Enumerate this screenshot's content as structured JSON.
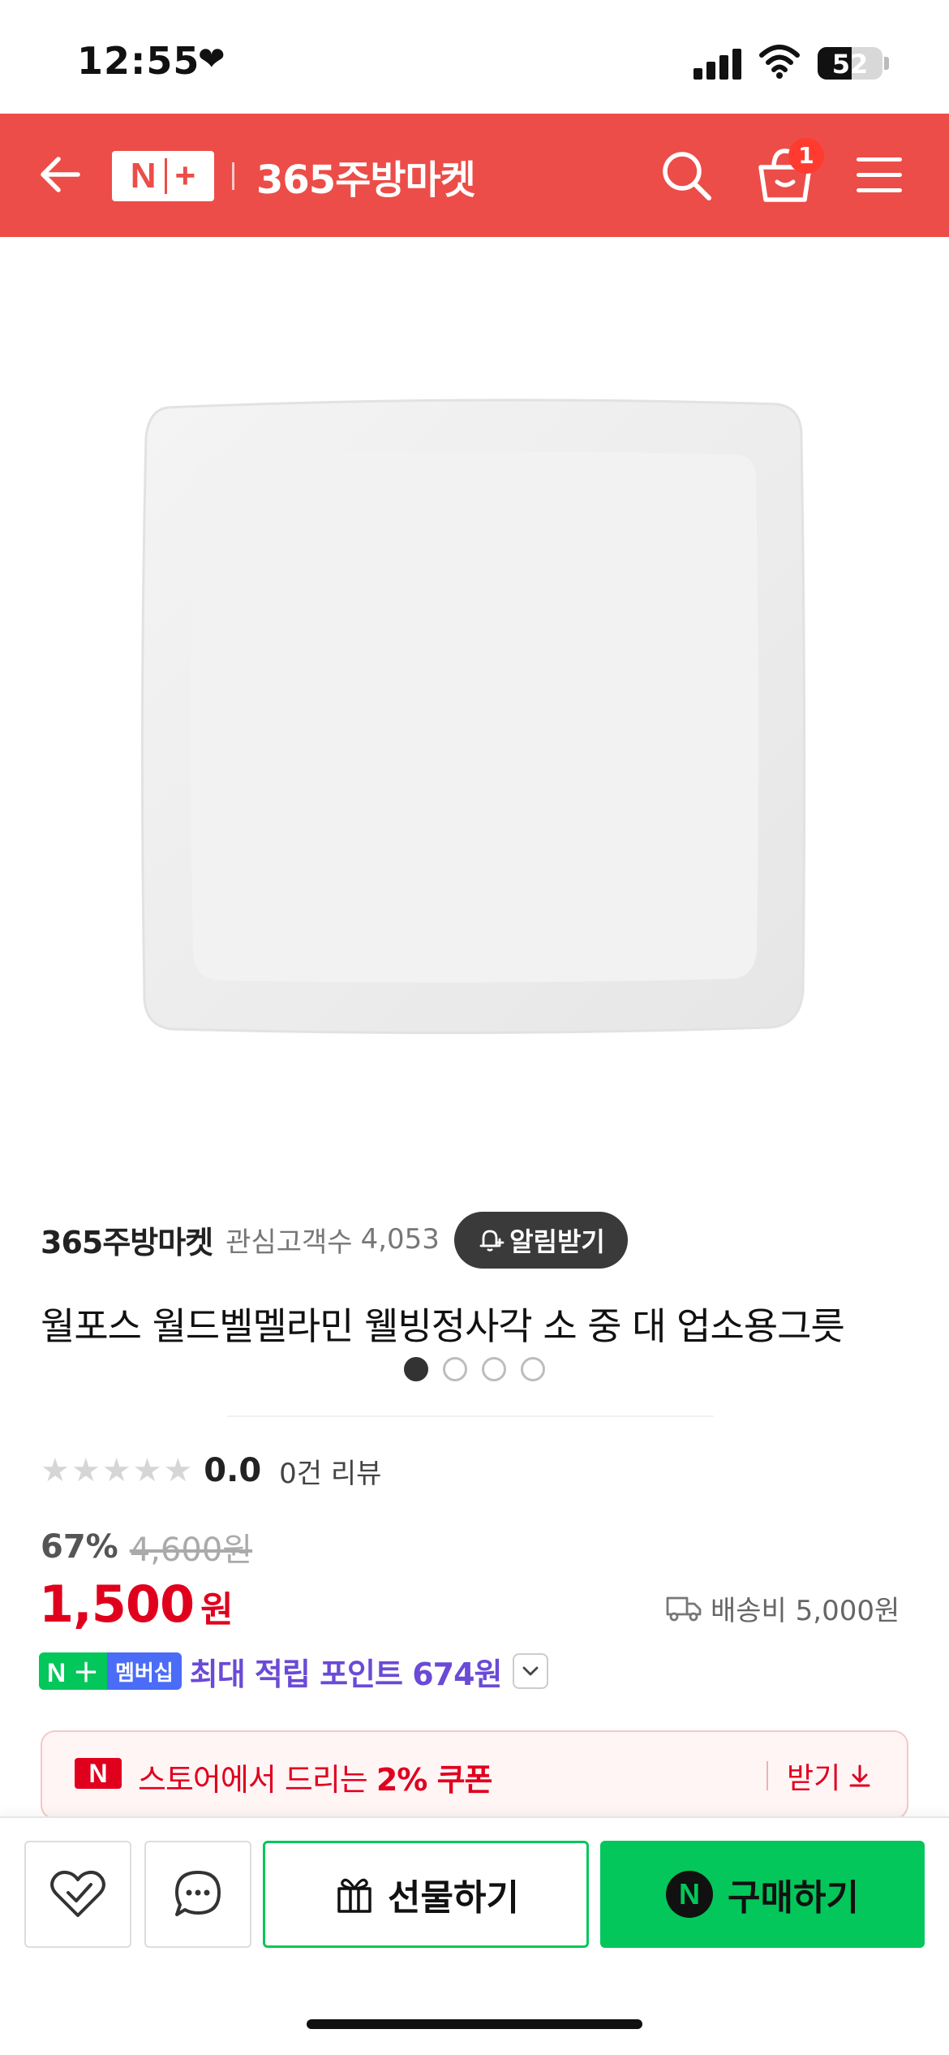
{
  "status_bar": {
    "time": "12:55",
    "battery": "52",
    "battery_level": 0.52
  },
  "header": {
    "logo_text": "N+",
    "store_title": "365주방마켓",
    "cart_count": "1",
    "brand_color": "#ec4d48"
  },
  "gallery": {
    "image_count": 4,
    "active_index": 0
  },
  "store": {
    "name": "365주방마켓",
    "fans_label": "관심고객수",
    "fans_count": "4,053",
    "notify_label": "알림받기"
  },
  "product": {
    "title": "월포스 월드벨멜라민 웰빙정사각 소 중 대 업소용그릇",
    "rating": "0.0",
    "stars_filled": 0,
    "stars_total": 5,
    "review_count": "0건 리뷰",
    "discount_rate": "67%",
    "original_price": "4,600원",
    "sale_price": "1,500",
    "price_unit": "원",
    "shipping": "배송비 5,000원"
  },
  "membership": {
    "badge_text": "멤버십",
    "points_text": "최대 적립 포인트 674원"
  },
  "coupon": {
    "text_prefix": "스토어에서 드리는 ",
    "text_bold": "2% 쿠폰",
    "get_label": "받기"
  },
  "bottom_bar": {
    "gift_label": "선물하기",
    "buy_label": "구매하기",
    "buy_color": "#03c75a"
  },
  "icons": {
    "back": "back-arrow-icon",
    "search": "search-icon",
    "cart": "shopping-bag-icon",
    "menu": "hamburger-menu-icon",
    "bell": "bell-plus-icon",
    "truck": "truck-icon",
    "wish": "heart-check-icon",
    "chat": "chat-bubble-icon",
    "gift": "gift-icon",
    "download": "download-icon"
  }
}
